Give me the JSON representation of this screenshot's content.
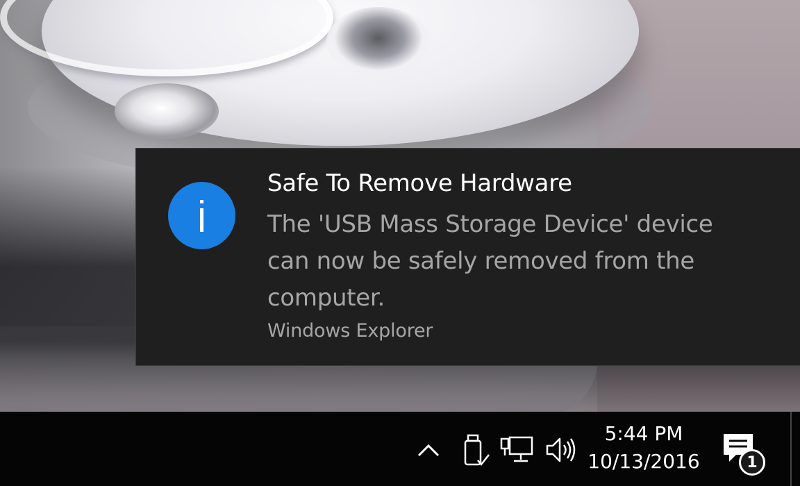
{
  "notification": {
    "title": "Safe To Remove Hardware",
    "message": "The 'USB Mass Storage Device' device can now be safely removed from the computer.",
    "source": "Windows Explorer",
    "icon": "info-icon",
    "icon_color": "#1a7fe3"
  },
  "taskbar": {
    "tray_icons": [
      "chevron-up-icon",
      "usb-drive-icon",
      "network-icon",
      "volume-icon"
    ],
    "clock": {
      "time": "5:44 PM",
      "date": "10/13/2016"
    },
    "action_center": {
      "icon": "message-icon",
      "badge_count": "1"
    }
  }
}
